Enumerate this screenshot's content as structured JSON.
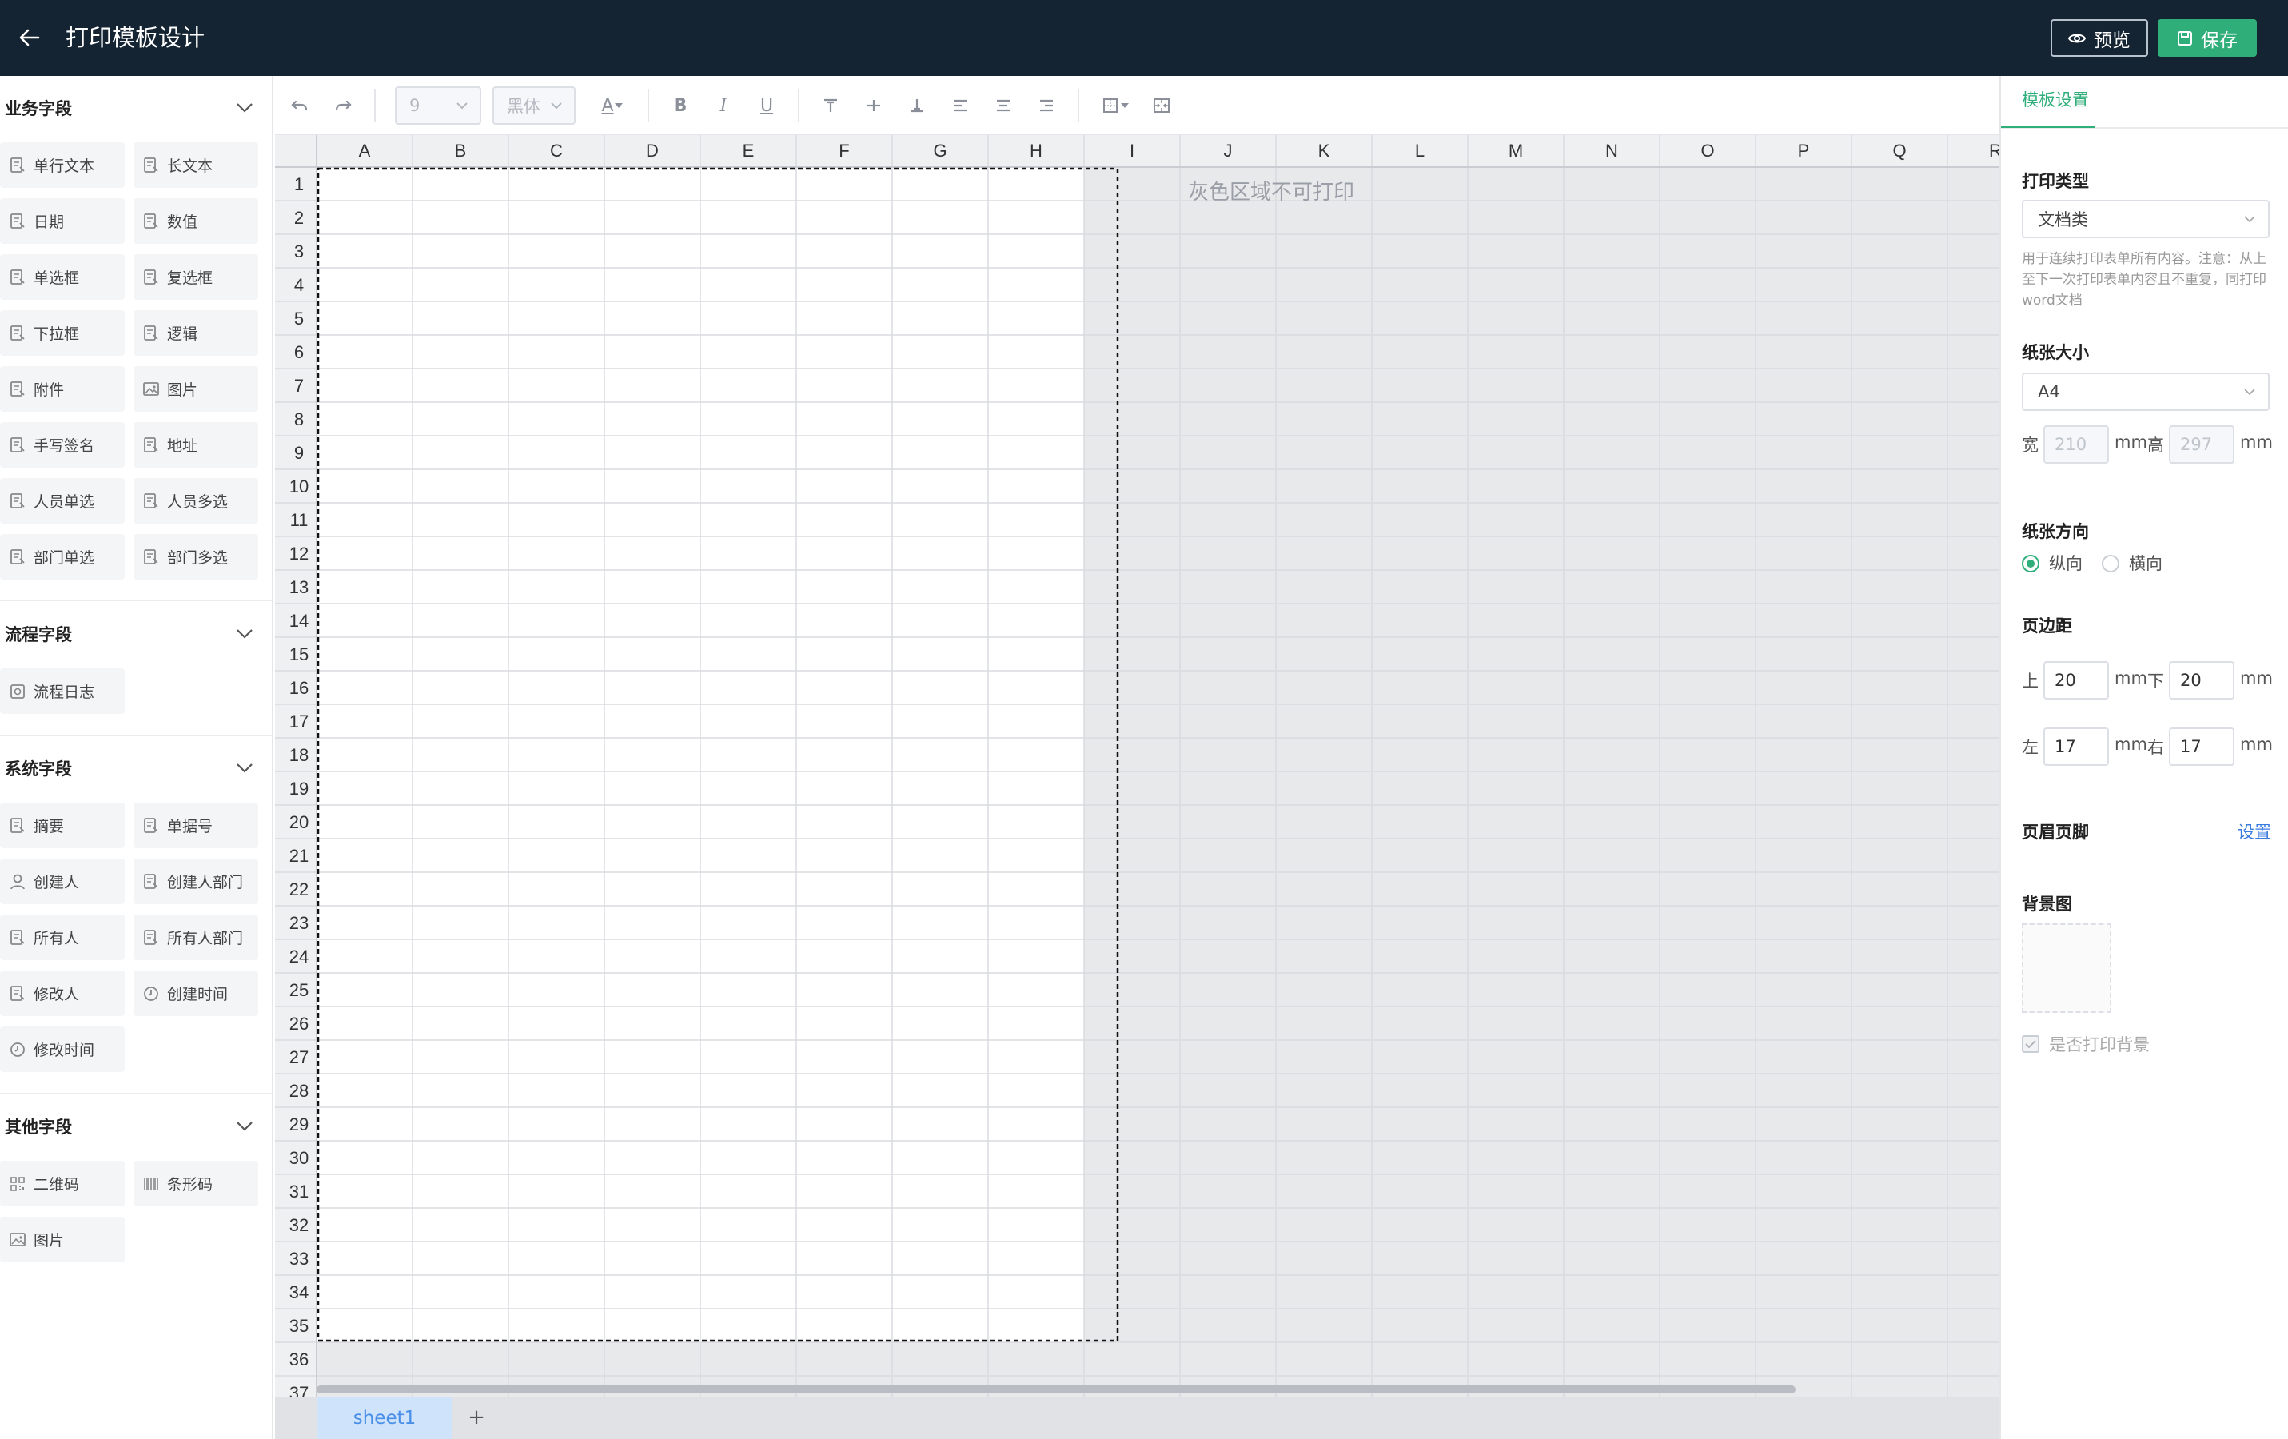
{
  "header": {
    "title": "打印模板设计",
    "preview_label": "预览",
    "save_label": "保存"
  },
  "left_panel": {
    "groups": [
      {
        "title": "业务字段",
        "fields": [
          {
            "label": "单行文本",
            "icon": "field-icon"
          },
          {
            "label": "长文本",
            "icon": "field-icon"
          },
          {
            "label": "日期",
            "icon": "field-icon"
          },
          {
            "label": "数值",
            "icon": "field-icon"
          },
          {
            "label": "单选框",
            "icon": "field-icon"
          },
          {
            "label": "复选框",
            "icon": "field-icon"
          },
          {
            "label": "下拉框",
            "icon": "field-icon"
          },
          {
            "label": "逻辑",
            "icon": "field-icon"
          },
          {
            "label": "附件",
            "icon": "field-icon"
          },
          {
            "label": "图片",
            "icon": "image-icon"
          },
          {
            "label": "手写签名",
            "icon": "field-icon"
          },
          {
            "label": "地址",
            "icon": "field-icon"
          },
          {
            "label": "人员单选",
            "icon": "field-icon"
          },
          {
            "label": "人员多选",
            "icon": "field-icon"
          },
          {
            "label": "部门单选",
            "icon": "field-icon"
          },
          {
            "label": "部门多选",
            "icon": "field-icon"
          }
        ]
      },
      {
        "title": "流程字段",
        "fields": [
          {
            "label": "流程日志",
            "icon": "log-icon"
          }
        ]
      },
      {
        "title": "系统字段",
        "fields": [
          {
            "label": "摘要",
            "icon": "field-icon"
          },
          {
            "label": "单据号",
            "icon": "field-icon"
          },
          {
            "label": "创建人",
            "icon": "user-icon"
          },
          {
            "label": "创建人部门",
            "icon": "field-icon"
          },
          {
            "label": "所有人",
            "icon": "field-icon"
          },
          {
            "label": "所有人部门",
            "icon": "field-icon"
          },
          {
            "label": "修改人",
            "icon": "field-icon"
          },
          {
            "label": "创建时间",
            "icon": "clock-icon"
          },
          {
            "label": "修改时间",
            "icon": "clock-icon"
          }
        ]
      },
      {
        "title": "其他字段",
        "fields": [
          {
            "label": "二维码",
            "icon": "qrcode-icon"
          },
          {
            "label": "条形码",
            "icon": "barcode-icon"
          },
          {
            "label": "图片",
            "icon": "image-icon"
          }
        ]
      }
    ]
  },
  "toolbar": {
    "font_size": "9",
    "font_family": "黑体",
    "font_color_glyph": "A"
  },
  "grid": {
    "columns": [
      "A",
      "B",
      "C",
      "D",
      "E",
      "F",
      "G",
      "H",
      "I",
      "J",
      "K",
      "L",
      "M",
      "N",
      "O",
      "P",
      "Q",
      "R"
    ],
    "row_count": 37,
    "print_area_cols": 8,
    "print_area_rows": 35,
    "non_print_hint": "灰色区域不可打印"
  },
  "sheets": {
    "tabs": [
      "sheet1"
    ],
    "add_label": "+"
  },
  "settings": {
    "tab_label": "模板设置",
    "print_type_label": "打印类型",
    "print_type_value": "文档类",
    "print_type_hint": "用于连续打印表单所有内容。注意：从上至下一次打印表单内容且不重复，同打印word文档",
    "paper_size_label": "纸张大小",
    "paper_size_value": "A4",
    "width_label": "宽",
    "width_value": "210",
    "height_label": "高",
    "height_value": "297",
    "unit": "mm",
    "orientation_label": "纸张方向",
    "orientation_portrait": "纵向",
    "orientation_landscape": "横向",
    "orientation_selected": "portrait",
    "margin_label": "页边距",
    "margin_top_label": "上",
    "margin_top": "20",
    "margin_bottom_label": "下",
    "margin_bottom": "20",
    "margin_left_label": "左",
    "margin_left": "17",
    "margin_right_label": "右",
    "margin_right": "17",
    "header_footer_label": "页眉页脚",
    "header_footer_link": "设置",
    "background_label": "背景图",
    "print_background_label": "是否打印背景",
    "print_background_checked": true,
    "accent_color": "#2fae79",
    "link_color": "#3a7be0"
  }
}
